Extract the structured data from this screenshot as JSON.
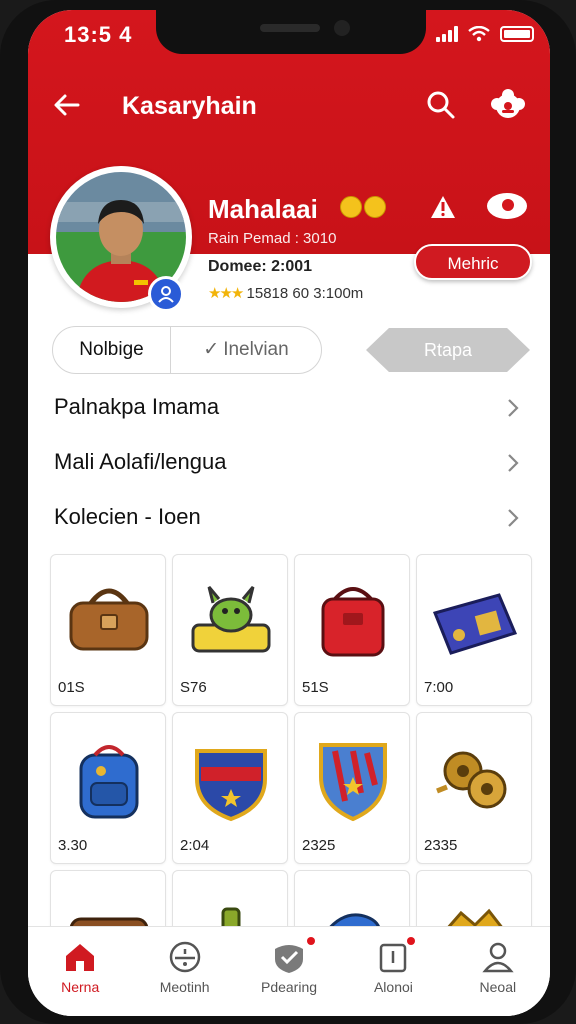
{
  "status_bar": {
    "time": "13:5 4"
  },
  "top_bar": {
    "title": "Kasaryhain"
  },
  "profile": {
    "name": "Mahalaai",
    "subtitle": "Rain Pemad : 3010",
    "stat_line1": "Domee: 2:001",
    "stat_line1_currency": "$",
    "stat_line2_stars": "★★★",
    "stat_line2": "15818 60 3:100m",
    "metric_button": "Mehric"
  },
  "segmented": {
    "option1": "Nolbige",
    "option2": "Inelvian",
    "check_glyph": "✓"
  },
  "arrow_button": "Rtapa",
  "list_items": [
    {
      "label": "Palnakpa Imama"
    },
    {
      "label": "Mali Aolafi/lengua"
    },
    {
      "label": "Kolecien - Ioen"
    }
  ],
  "grid_items": [
    {
      "icon": "leather-bag-icon",
      "value": "01S"
    },
    {
      "icon": "green-creature-bag-icon",
      "value": "S76"
    },
    {
      "icon": "red-backpack-icon",
      "value": "51S"
    },
    {
      "icon": "blue-pouch-icon",
      "value": "7:00"
    },
    {
      "icon": "blue-backpack-icon",
      "value": "3.30"
    },
    {
      "icon": "team-crest-icon",
      "value": "2:04"
    },
    {
      "icon": "shield-crest-icon",
      "value": "2325"
    },
    {
      "icon": "golden-gears-icon",
      "value": "2335"
    },
    {
      "icon": "brown-chest-icon",
      "value": ""
    },
    {
      "icon": "green-bottle-icon",
      "value": ""
    },
    {
      "icon": "blue-item-icon",
      "value": ""
    },
    {
      "icon": "gold-item-icon",
      "value": ""
    }
  ],
  "tab_bar": [
    {
      "label": "Nerna",
      "icon": "home-icon",
      "active": true
    },
    {
      "label": "Meotinh",
      "icon": "compass-icon",
      "active": false
    },
    {
      "label": "Pdearing",
      "icon": "check-shield-icon",
      "active": false
    },
    {
      "label": "Alonoi",
      "icon": "notification-icon",
      "active": false
    },
    {
      "label": "Neoal",
      "icon": "profile-icon",
      "active": false
    }
  ],
  "colors": {
    "brand_red": "#d4161d",
    "accent_blue": "#2a5bd7",
    "star_gold": "#f2b40a"
  }
}
